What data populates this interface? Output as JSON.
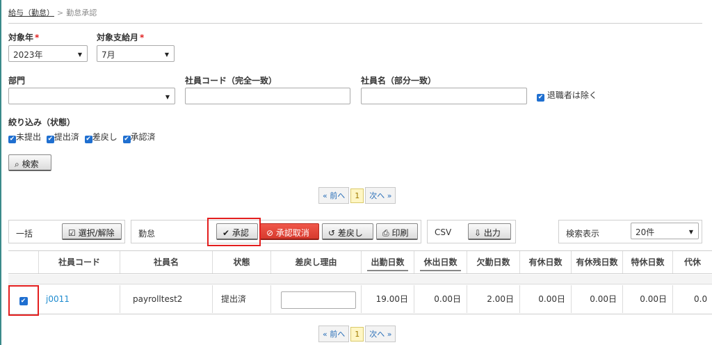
{
  "breadcrumb": {
    "parent": "給与（勤怠）",
    "separator": ">",
    "current": "勤怠承認"
  },
  "filters": {
    "year_label": "対象年",
    "year_value": "2023年",
    "month_label": "対象支給月",
    "month_value": "7月",
    "required_mark": "*",
    "dept_label": "部門",
    "dept_value": "",
    "emp_code_label": "社員コード（完全一致）",
    "emp_code_value": "",
    "emp_name_label": "社員名（部分一致）",
    "emp_name_value": "",
    "exclude_retired_label": "退職者は除く",
    "status_filter_label": "絞り込み（状態）",
    "status_options": [
      "未提出",
      "提出済",
      "差戻し",
      "承認済"
    ],
    "search_button": "検索"
  },
  "pager": {
    "prev": "« 前へ",
    "current": "1",
    "next": "次へ »"
  },
  "toolbar": {
    "bulk_label": "一括",
    "select_toggle": "選択/解除",
    "attendance_label": "勤怠",
    "approve": "承認",
    "cancel_approve": "承認取消",
    "send_back": "差戻し",
    "print": "印刷",
    "csv_label": "CSV",
    "export": "出力",
    "display_label": "検索表示",
    "display_value": "20件"
  },
  "table": {
    "headers": [
      "社員コード",
      "社員名",
      "状態",
      "差戻し理由",
      "出勤日数",
      "休出日数",
      "欠勤日数",
      "有休日数",
      "有休残日数",
      "特休日数",
      "代休"
    ],
    "rows": [
      {
        "checked": true,
        "code": "j0011",
        "name": "payrolltest2",
        "status": "提出済",
        "reason": "",
        "work_days": "19.00日",
        "holiday_work_days": "0.00日",
        "absence_days": "2.00日",
        "paid_leave_days": "0.00日",
        "paid_leave_remaining": "0.00日",
        "special_leave_days": "0.00日",
        "comp_leave_days": "0.0"
      }
    ]
  },
  "colors": {
    "accent_red": "#e31e1e",
    "checkbox_blue": "#1f6fd0",
    "link_blue": "#1f8ccf"
  }
}
